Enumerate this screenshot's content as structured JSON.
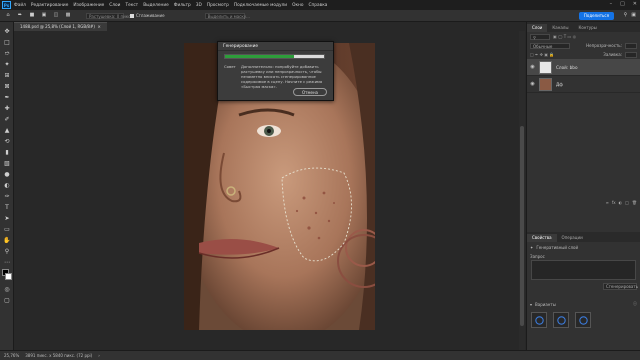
{
  "menu": {
    "app_logo": "Ps",
    "items": [
      "Файл",
      "Редактирование",
      "Изображение",
      "Слои",
      "Текст",
      "Выделение",
      "Фильтр",
      "3D",
      "Просмотр",
      "Подключаемые модули",
      "Окно",
      "Справка"
    ]
  },
  "options": {
    "field1_placeholder": "Растушевка: 0 пикс.",
    "antialias_label": "Сглаживание",
    "style_placeholder": "Выделить и маску...",
    "share_label": "Поделиться"
  },
  "document": {
    "tab_label": "1488.psd @ 25,8% (Слой 1, RGB/8#)"
  },
  "status": {
    "zoom": "25,76%",
    "info": "3891 пикс. x 5840 пикс. (72 ppi)"
  },
  "dialog": {
    "title": "Генерирование",
    "progress": 0.7,
    "tip_label": "Совет",
    "tip_text": "Дополнительно: попробуйте добавить растушевку или непрозрачность, чтобы незаметно вписать сгенерированное содержимое в сцену. Начните с режима «Быстрая маска».",
    "cancel_label": "Отмена"
  },
  "layers_panel": {
    "tabs": [
      "Слои",
      "Каналы",
      "Контуры"
    ],
    "blend_mode": "Обычные",
    "opacity_label": "Непрозрачность:",
    "fill_label": "Заливка:",
    "layers": [
      {
        "name": "Слой: bbo",
        "selected": true
      },
      {
        "name": "Дф",
        "selected": false
      }
    ]
  },
  "properties_panel": {
    "tabs": [
      "Свойства",
      "Операции"
    ],
    "type_label": "Генеративный слой",
    "prompt_label": "Запрос",
    "generate_label": "Сгенерировать",
    "variations_label": "Варианты"
  },
  "colors": {
    "accent": "#1473e6",
    "progress": "#2d9d3a"
  }
}
